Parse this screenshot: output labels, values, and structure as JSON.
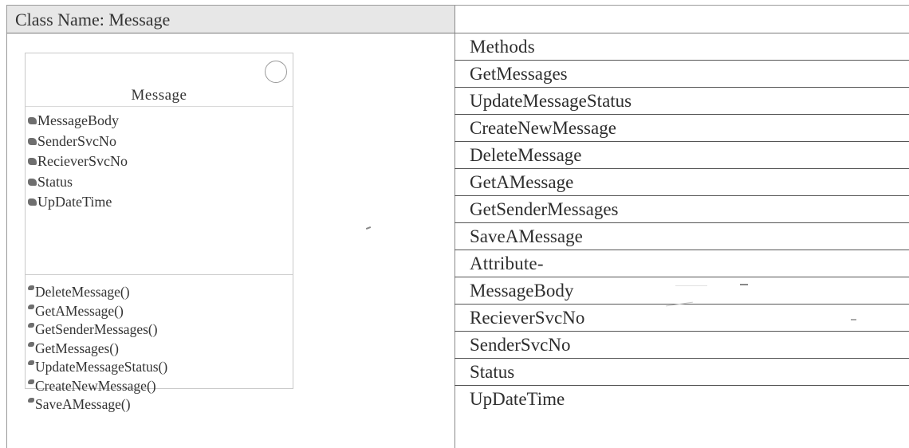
{
  "header": {
    "class_name_label": "Class Name: Message"
  },
  "uml_class": {
    "name": "Message",
    "attributes": [
      "MessageBody",
      "SenderSvcNo",
      "RecieverSvcNo",
      "Status",
      "UpDateTime"
    ],
    "operations": [
      "DeleteMessage()",
      "GetAMessage()",
      "GetSenderMessages()",
      "GetMessages()",
      "UpdateMessageStatus()",
      "CreateNewMessage()",
      "SaveAMessage()"
    ]
  },
  "table": {
    "methods_header": "Methods",
    "methods": [
      "GetMessages",
      "UpdateMessageStatus",
      "CreateNewMessage",
      "DeleteMessage",
      "GetAMessage",
      "GetSenderMessages",
      "SaveAMessage"
    ],
    "attribute_header": "Attribute-",
    "attributes": [
      "MessageBody",
      "RecieverSvcNo",
      "SenderSvcNo",
      "Status",
      "UpDateTime"
    ]
  }
}
